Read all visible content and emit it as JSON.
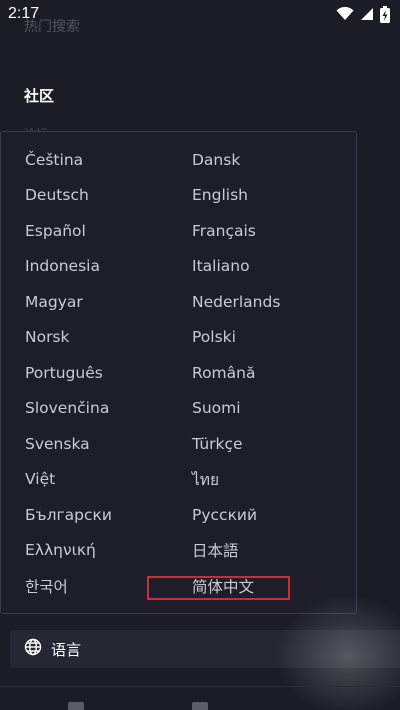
{
  "status_bar": {
    "time": "2:17",
    "icons": [
      "wifi-icon",
      "signal-icon",
      "battery-charging-icon"
    ]
  },
  "background_text": {
    "top_faded": "热门搜索",
    "section_heading": "社区",
    "sub_faded": "论坛"
  },
  "language_menu": {
    "options": [
      "Čeština",
      "Dansk",
      "Deutsch",
      "English",
      "Español",
      "Français",
      "Indonesia",
      "Italiano",
      "Magyar",
      "Nederlands",
      "Norsk",
      "Polski",
      "Português",
      "Română",
      "Slovenčina",
      "Suomi",
      "Svenska",
      "Türkçe",
      "Việt",
      "ไทย",
      "Български",
      "Русский",
      "Ελληνική",
      "日本語",
      "한국어",
      "简体中文"
    ],
    "selected": "简体中文"
  },
  "language_button": {
    "icon": "globe-icon",
    "label": "语言"
  },
  "colors": {
    "background": "#1b1c26",
    "panel": "#1d1e2a",
    "highlight": "#c62f33",
    "text": "#c9cbd4"
  }
}
